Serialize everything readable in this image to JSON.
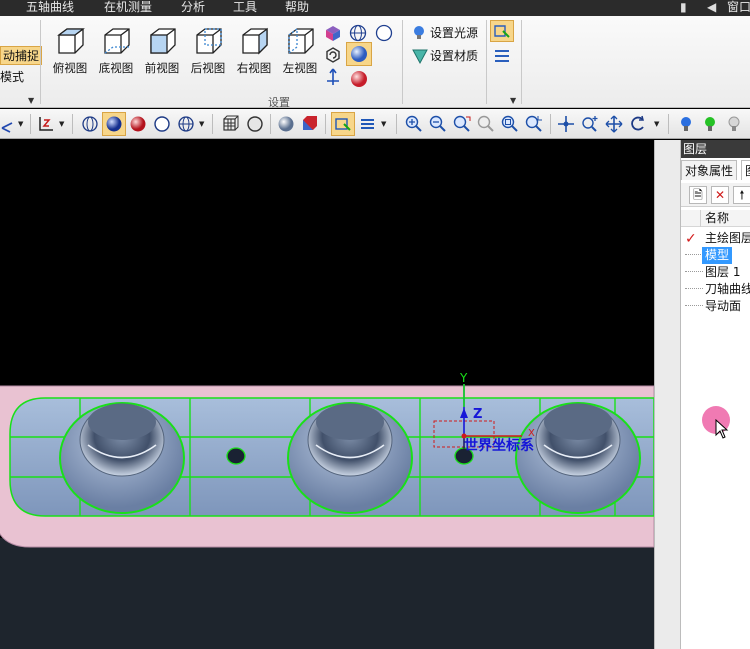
{
  "menubar": {
    "items": [
      "五轴曲线",
      "在机测量",
      "分析",
      "工具",
      "帮助"
    ],
    "right_label": "窗口"
  },
  "ribbon": {
    "left_items": [
      "动捕捉",
      "模式"
    ],
    "views": [
      "俯视图",
      "底视图",
      "前视图",
      "后视图",
      "右视图",
      "左视图"
    ],
    "light_label": "设置光源",
    "material_label": "设置材质",
    "group_caption": "设置"
  },
  "viewport": {
    "background": "#000000",
    "part_color": "#8fa6c8",
    "edge_color": "#19e019",
    "axis": {
      "y_label": "Y",
      "z_label": "Z",
      "x_label": "X",
      "caption": "世界坐标系"
    }
  },
  "panel": {
    "title": "图层",
    "tabs": [
      "对象属性",
      "图"
    ],
    "column_header": "名称",
    "layers": [
      {
        "name": "主绘图层",
        "checked": true,
        "selected": false
      },
      {
        "name": "模型",
        "checked": false,
        "selected": true
      },
      {
        "name": "图层 1",
        "checked": false,
        "selected": false
      },
      {
        "name": "刀轴曲线",
        "checked": false,
        "selected": false
      },
      {
        "name": "导动面",
        "checked": false,
        "selected": false
      }
    ]
  }
}
